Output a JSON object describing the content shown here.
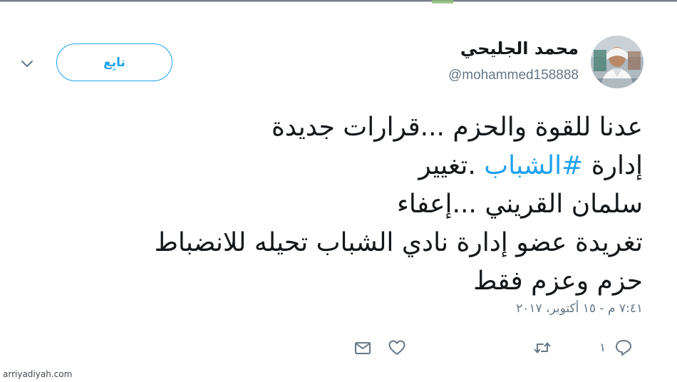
{
  "author": {
    "display_name": "محمد الجليحي",
    "handle": "@mohammed158888",
    "avatar_icon": "user-avatar-photo"
  },
  "follow_button": {
    "label": "تابِع"
  },
  "menu": {
    "caret_icon": "chevron-down-icon"
  },
  "tweet": {
    "line1": "عدنا للقوة والحزم ...قرارات جديدة",
    "line2_prefix": "إدارة ",
    "hashtag": "#الشباب",
    "line2_suffix": " .تغيير",
    "line3": "سلمان القريني ...إعفاء",
    "line4": "تغريدة عضو إدارة نادي الشباب تحيله  للانضباط",
    "line5": "حزم وعزم فقط",
    "timestamp": "٧:٤١ م - ١٥ أكتوبر، ٢٠١٧"
  },
  "actions": {
    "reply_count": "١",
    "reply_icon": "reply-icon",
    "retweet_icon": "retweet-icon",
    "like_icon": "heart-icon",
    "dm_icon": "envelope-icon"
  },
  "watermark": "arriyadiyah.com",
  "colors": {
    "accent": "#1da1f2",
    "text": "#14171a",
    "muted": "#657786"
  }
}
